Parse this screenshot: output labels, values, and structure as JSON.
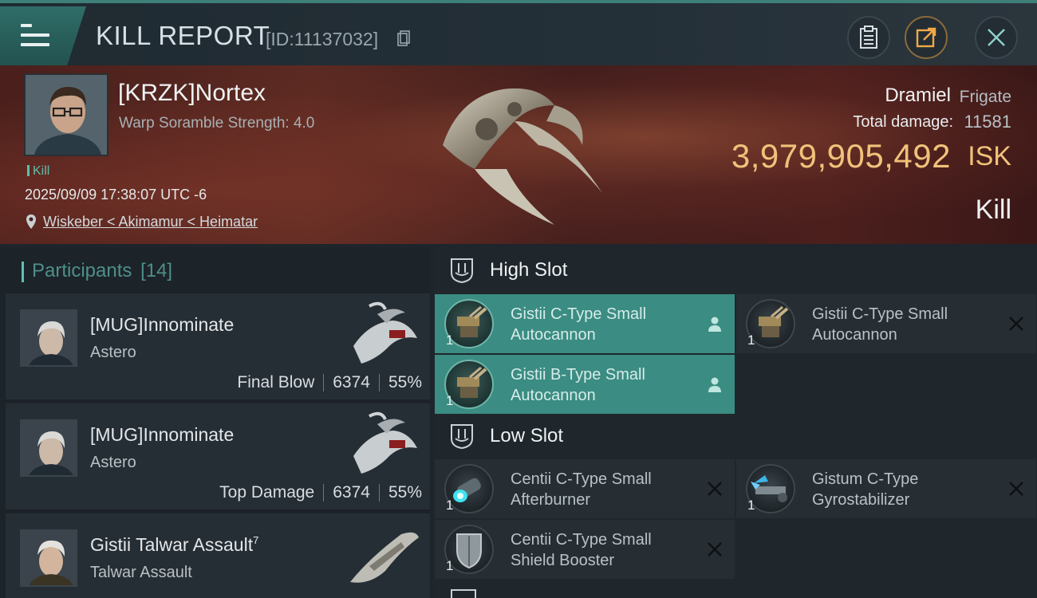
{
  "header": {
    "title": "KILL REPORT",
    "report_id": "[ID:11137032]"
  },
  "victim": {
    "name": "[KRZK]Nortex",
    "warp_scramble": "Warp Soramble Strength: 4.0",
    "kill_tag": "Kill",
    "datetime": "2025/09/09 17:38:07 UTC -6",
    "location": "Wiskeber < Akimamur < Heimatar",
    "ship_name": "Dramiel",
    "ship_class": "Frigate",
    "total_damage_label": "Total damage:",
    "total_damage": "11581",
    "isk_value": "3,979,905,492",
    "isk_unit": "ISK",
    "result": "Kill"
  },
  "participants": {
    "label": "Participants",
    "count": "[14]",
    "items": [
      {
        "name": "[MUG]Innominate",
        "ship": "Astero",
        "role": "Final Blow",
        "damage": "6374",
        "percent": "55%"
      },
      {
        "name": "[MUG]Innominate",
        "ship": "Astero",
        "role": "Top Damage",
        "damage": "6374",
        "percent": "55%"
      },
      {
        "name": "Gistii Talwar Assault",
        "sup": "7",
        "ship": "Talwar Assault"
      }
    ]
  },
  "slots": {
    "high": {
      "label": "High Slot",
      "modules": [
        {
          "qty": "1",
          "name": "Gistii C-Type Small Autocannon",
          "status": "dropped"
        },
        {
          "qty": "1",
          "name": "Gistii C-Type Small Autocannon",
          "status": "destroyed"
        },
        {
          "qty": "1",
          "name": "Gistii B-Type Small Autocannon",
          "status": "dropped"
        }
      ]
    },
    "low": {
      "label": "Low Slot",
      "modules": [
        {
          "qty": "1",
          "name": "Centii C-Type Small Afterburner",
          "status": "destroyed"
        },
        {
          "qty": "1",
          "name": "Gistum C-Type Gyrostabilizer",
          "status": "destroyed"
        },
        {
          "qty": "1",
          "name": "Centii C-Type Small Shield Booster",
          "status": "destroyed"
        }
      ]
    }
  },
  "colors": {
    "accent": "#3b8c82",
    "isk": "#f0c27a",
    "banner": "#4a1f1c"
  }
}
